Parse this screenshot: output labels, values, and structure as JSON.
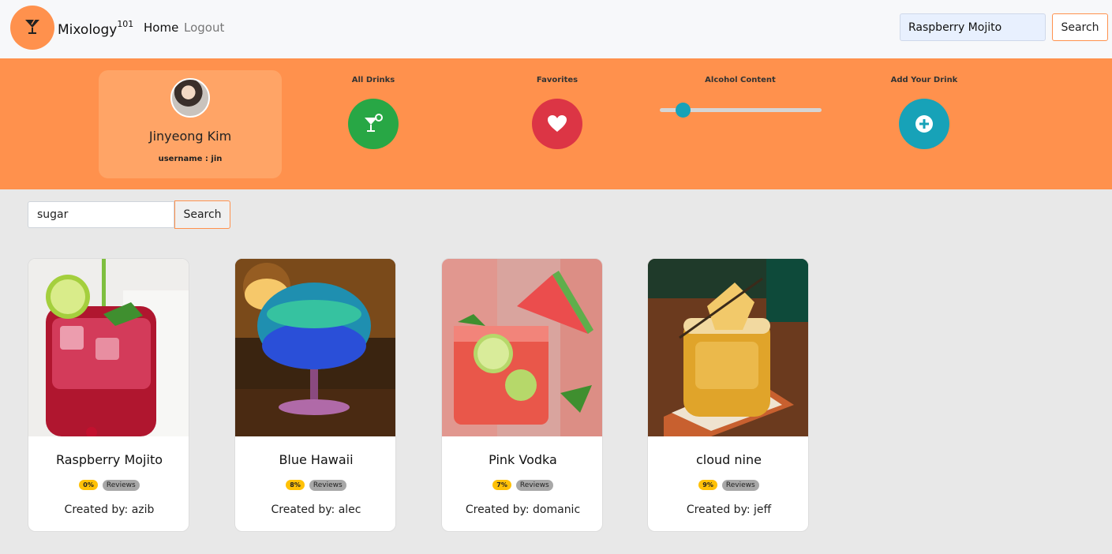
{
  "nav": {
    "brand": "Mixology",
    "brand_sup": "101",
    "links": [
      "Home",
      "Logout"
    ],
    "search_value": "Raspberry Mojito",
    "search_button": "Search"
  },
  "profile": {
    "name": "Jinyeong Kim",
    "username": "username : jin"
  },
  "actions": {
    "all_drinks": "All Drinks",
    "favorites": "Favorites",
    "alcohol_content": "Alcohol Content",
    "add_drink": "Add Your Drink",
    "alcohol_slider_level": 0.14
  },
  "search": {
    "value": "sugar",
    "button": "Search"
  },
  "cards": [
    {
      "title": "Raspberry Mojito",
      "pct": "0%",
      "reviews": "Reviews",
      "creator": "Created by:  azib"
    },
    {
      "title": "Blue Hawaii",
      "pct": "8%",
      "reviews": "Reviews",
      "creator": "Created by:  alec"
    },
    {
      "title": "Pink Vodka",
      "pct": "7%",
      "reviews": "Reviews",
      "creator": "Created by:  domanic"
    },
    {
      "title": "cloud nine",
      "pct": "9%",
      "reviews": "Reviews",
      "creator": "Created by:  jeff"
    }
  ],
  "colors": {
    "accent": "#ff914d",
    "drinks": "#28a745",
    "favorites": "#dc3545",
    "add": "#17a2b8",
    "badge": "#ffc107"
  }
}
